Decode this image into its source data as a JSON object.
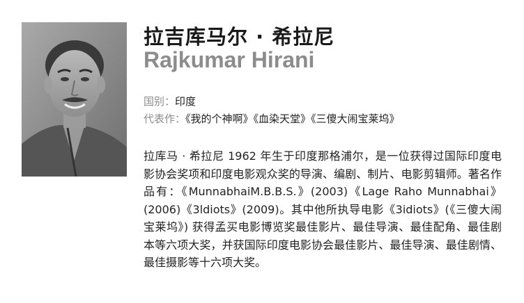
{
  "person": {
    "name_cn": "拉吉库马尔 · 希拉尼",
    "name_en": "Rajkumar Hirani",
    "country_label": "国别：",
    "country_value": "印度",
    "works_label": "代表作：",
    "works_value": "《我的个神啊》《血染天堂》《三傻大闹宝莱坞》",
    "bio": "拉库马 · 希拉尼 1962 年生于印度那格浦尔，是一位获得过国际印度电影协会奖项和印度电影观众奖的导演、编剧、制片、电影剪辑师。著名作品有：《MunnabhaiM.B.B.S.》(2003)《Lage Raho Munnabhai》(2006)《3ldiots》(2009)。其中他所执导电影《3idiots》(《三傻大闹宝莱坞》) 获得孟买电影博览奖最佳影片、最佳导演、最佳配角、最佳剧本等六项大奖，并获国际印度电影协会最佳影片、最佳导演、最佳剧情、最佳摄影等十六项大奖。"
  }
}
